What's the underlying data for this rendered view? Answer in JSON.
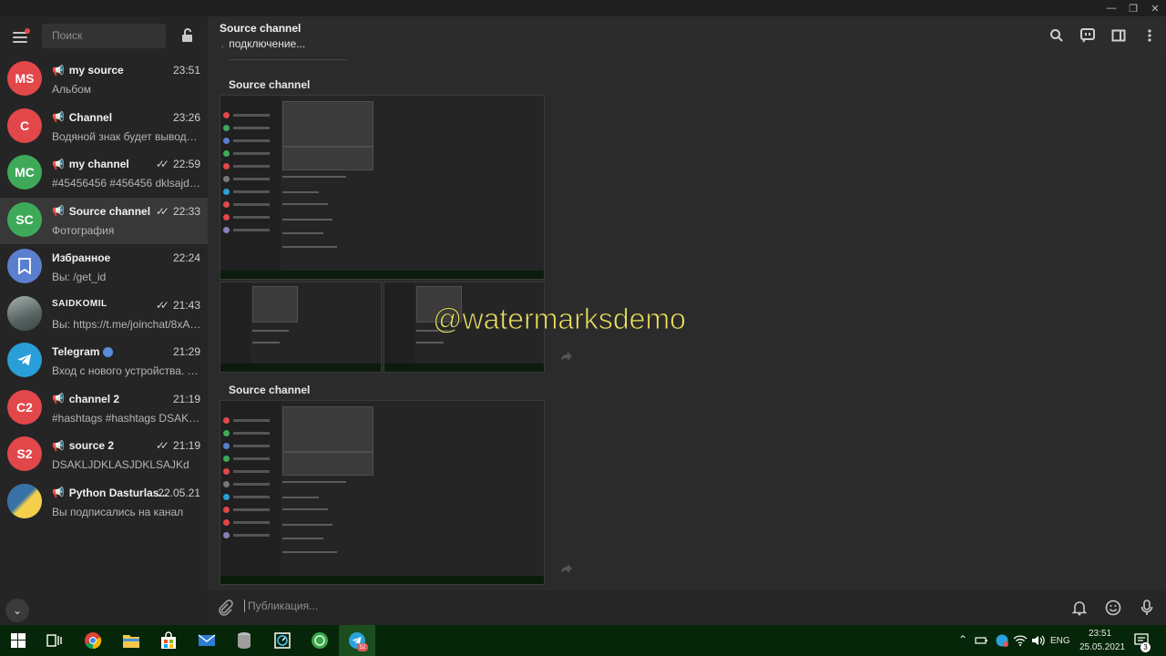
{
  "sidebar": {
    "search_placeholder": "Поиск",
    "chats": [
      {
        "initials": "MS",
        "color": "#e2474a",
        "name": "my source",
        "time": "23:51",
        "preview": "Альбом",
        "channel": true,
        "ticks": false
      },
      {
        "initials": "C",
        "color": "#e2474a",
        "name": "Channel",
        "time": "23:26",
        "preview": "Водяной знак будет выводить...",
        "channel": true,
        "ticks": false
      },
      {
        "initials": "MC",
        "color": "#3eaa59",
        "name": "my channel",
        "time": "22:59",
        "preview": "#45456456 #456456  dklsajdkla...",
        "channel": true,
        "ticks": true
      },
      {
        "initials": "SC",
        "color": "#3eaa59",
        "name": "Source channel",
        "time": "22:33",
        "preview": "Фотография",
        "channel": true,
        "ticks": true
      },
      {
        "initials": "",
        "color": "#5b7fcf",
        "name": "Избранное",
        "time": "22:24",
        "preview": "Вы: /get_id",
        "channel": false,
        "ticks": false
      },
      {
        "initials": "",
        "color": "#6f7b78",
        "name": "SAIDKOMIL",
        "time": "21:43",
        "preview": "Вы: https://t.me/joinchat/8xA0...",
        "channel": false,
        "ticks": true
      },
      {
        "initials": "",
        "color": "#2a9ed8",
        "name": "Telegram",
        "time": "21:29",
        "preview": "Вход с нового устройства. Bitt...",
        "channel": false,
        "ticks": false
      },
      {
        "initials": "C2",
        "color": "#e2474a",
        "name": "channel 2",
        "time": "21:19",
        "preview": "#hashtags #hashtags  DSAKLJ...",
        "channel": true,
        "ticks": false
      },
      {
        "initials": "S2",
        "color": "#e2474a",
        "name": "source 2",
        "time": "21:19",
        "preview": "DSAKLJDKLASJDKLSAJKd",
        "channel": true,
        "ticks": true
      },
      {
        "initials": "",
        "color": "#8a7fb8",
        "name": "Python Dasturlas...",
        "time": "22.05.21",
        "preview": "Вы подписались на канал",
        "channel": true,
        "ticks": false
      }
    ]
  },
  "main": {
    "title": "Source channel",
    "status": "подключение...",
    "posts": [
      {
        "label": "Source channel"
      },
      {
        "label": "Source channel"
      }
    ],
    "watermark": "@watermarksdemo",
    "composer_placeholder": "Публикация..."
  },
  "taskbar": {
    "lang": "ENG",
    "time": "23:51",
    "date": "25.05.2021",
    "telegram_badge": "52",
    "notif_count": "3"
  }
}
